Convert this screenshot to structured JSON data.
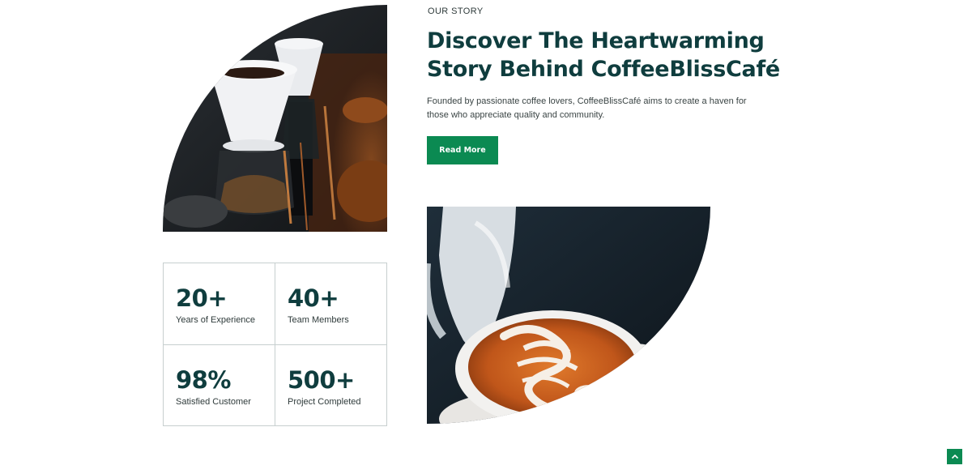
{
  "story": {
    "eyebrow": "OUR STORY",
    "headline": "Discover The Heartwarming Story Behind CoffeeBlissCafé",
    "description": "Founded by passionate coffee lovers, CoffeeBlissCafé aims to create a haven for those who appreciate quality and community.",
    "cta_label": "Read More"
  },
  "stats": [
    {
      "value": "20+",
      "label": "Years of Experience"
    },
    {
      "value": "40+",
      "label": "Team Members"
    },
    {
      "value": "98%",
      "label": "Satisfied Customer"
    },
    {
      "value": "500+",
      "label": "Project Completed"
    }
  ],
  "images": {
    "top": "pour-over-coffee-drippers-photo",
    "bottom": "latte-art-pour-photo"
  },
  "scroll_top_icon": "chevron-up-icon",
  "colors": {
    "heading": "#0f3d3e",
    "accent": "#0b8a52",
    "border": "#c7cfcf",
    "body_text": "#3a4444"
  }
}
